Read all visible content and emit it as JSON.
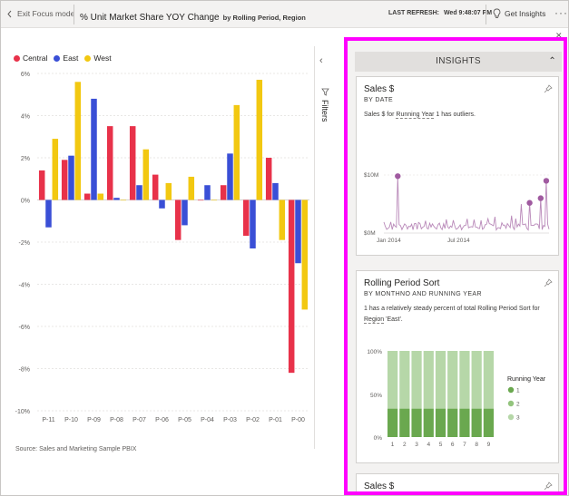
{
  "topbar": {
    "exit_label": "Exit Focus mode",
    "title": "% Unit Market Share YOY Change",
    "subtitle": "by Rolling Period, Region",
    "refresh_label": "LAST REFRESH:",
    "refresh_time": "Wed 9:48:07 PM",
    "get_insights_label": "Get Insights",
    "more_label": "···"
  },
  "chart_data": {
    "type": "bar",
    "categories": [
      "P-11",
      "P-10",
      "P-09",
      "P-08",
      "P-07",
      "P-06",
      "P-05",
      "P-04",
      "P-03",
      "P-02",
      "P-01",
      "P-00"
    ],
    "series": [
      {
        "name": "Central",
        "color": "#e8324a",
        "values": [
          1.4,
          1.9,
          0.3,
          3.5,
          3.5,
          1.2,
          -1.9,
          0.0,
          0.7,
          -1.7,
          2.0,
          -8.2
        ]
      },
      {
        "name": "East",
        "color": "#3a4fd6",
        "values": [
          -1.3,
          2.1,
          4.8,
          0.1,
          0.7,
          -0.4,
          -1.2,
          0.7,
          2.2,
          -2.3,
          0.8,
          -3.0
        ]
      },
      {
        "name": "West",
        "color": "#f2c811",
        "values": [
          2.9,
          5.6,
          0.3,
          0.0,
          2.4,
          0.8,
          1.1,
          0.0,
          4.5,
          5.7,
          -1.9,
          -5.2
        ]
      }
    ],
    "yticks": [
      "6%",
      "4%",
      "2%",
      "0%",
      "-2%",
      "-4%",
      "-6%",
      "-8%",
      "-10%"
    ],
    "ylim": [
      -10,
      6
    ]
  },
  "source_label": "Source: Sales and Marketing Sample PBIX",
  "filters_label": "Filters",
  "insights": {
    "header": "INSIGHTS",
    "card1": {
      "title": "Sales $",
      "subtitle": "BY DATE",
      "desc_pre": "Sales $ for ",
      "desc_link": "Running Year",
      "desc_post": " 1 has outliers.",
      "y_labels": [
        "$10M",
        "$0M"
      ],
      "x_labels": [
        "Jan 2014",
        "Jul 2014"
      ]
    },
    "card2": {
      "title": "Rolling Period Sort",
      "subtitle": "BY MONTHNO AND RUNNING YEAR",
      "desc_pre": "1 has a relatively steady percent of total Rolling Period Sort for ",
      "desc_link": "Region",
      "desc_post": " 'East'.",
      "y_labels": [
        "100%",
        "50%",
        "0%"
      ],
      "x_labels": [
        "1",
        "2",
        "3",
        "4",
        "5",
        "6",
        "7",
        "8",
        "9"
      ],
      "legend_title": "Running Year",
      "legend_items": [
        "1",
        "2",
        "3"
      ],
      "legend_colors": [
        "#6aa84f",
        "#93c47d",
        "#b6d7a8"
      ],
      "bar_share_year1": 0.33
    },
    "card3": {
      "title": "Sales $"
    }
  }
}
